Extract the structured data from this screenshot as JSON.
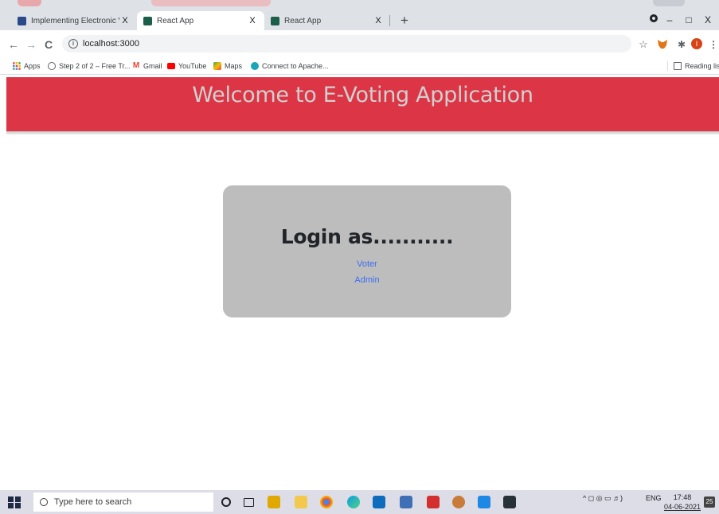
{
  "browser": {
    "tabs": [
      {
        "title": "Implementing Electronic Voting",
        "close": "X",
        "icon": "document-icon",
        "active": false
      },
      {
        "title": "React App",
        "close": "X",
        "icon": "react-icon",
        "active": true
      },
      {
        "title": "React App",
        "close": "X",
        "icon": "react-icon",
        "active": false
      }
    ],
    "new_tab": "+",
    "window_controls": {
      "minimize": "–",
      "maximize": "□",
      "close": "X"
    },
    "nav": {
      "back": "←",
      "forward": "→",
      "reload": "C"
    },
    "url": "localhost:3000",
    "bookmarks": [
      {
        "label": "Apps",
        "icon": "apps-grid-icon"
      },
      {
        "label": "Step 2 of 2 – Free Tr...",
        "icon": "settings-icon"
      },
      {
        "label": "Gmail",
        "icon": "gmail-icon"
      },
      {
        "label": "YouTube",
        "icon": "youtube-icon"
      },
      {
        "label": "Maps",
        "icon": "maps-icon"
      },
      {
        "label": "Connect to Apache...",
        "icon": "apache-icon"
      }
    ],
    "reading_list": "Reading list",
    "profile_initial": "I"
  },
  "page": {
    "header_title": "Welcome to E-Voting Application",
    "login_title": "Login as...........",
    "options": [
      "Voter",
      "Admin"
    ]
  },
  "taskbar": {
    "search_placeholder": "Type here to search",
    "language": "ENG",
    "time": "17:48",
    "date": "04-06-2021",
    "notification_count": "25"
  },
  "colors": {
    "header_red": "#dc3545",
    "card_gray": "#bdbdbd",
    "link_blue": "#3b6ef0",
    "tabstrip": "#dee1e6"
  }
}
